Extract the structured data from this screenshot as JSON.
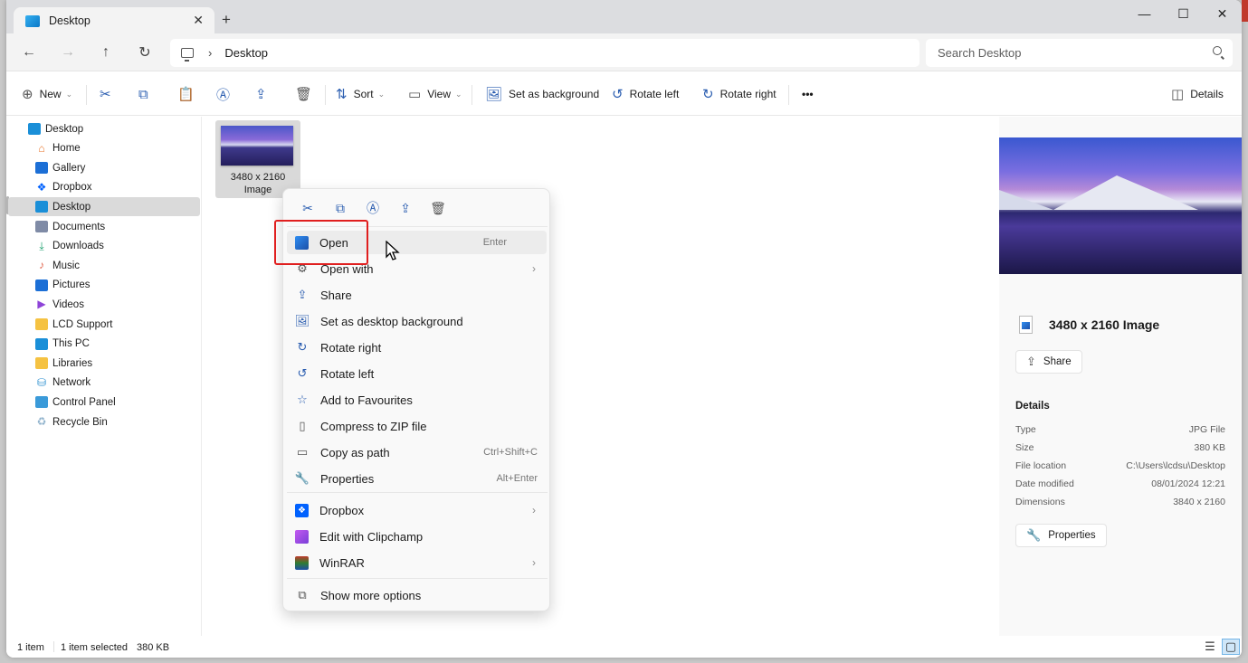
{
  "window": {
    "tab_title": "Desktop",
    "new_tab": "+",
    "controls": {
      "minimize": "—",
      "maximize": "☐",
      "close": "✕"
    }
  },
  "nav": {
    "back": "←",
    "forward": "→",
    "up": "↑",
    "refresh": "↻",
    "breadcrumb_sep": "›",
    "breadcrumb": [
      "Desktop"
    ],
    "search_placeholder": "Search Desktop"
  },
  "toolbar": {
    "new_label": "New",
    "sort_label": "Sort",
    "view_label": "View",
    "set_background_label": "Set as background",
    "rotate_left_label": "Rotate left",
    "rotate_right_label": "Rotate right",
    "more_label": "•••",
    "details_label": "Details"
  },
  "sidebar": {
    "items": [
      {
        "label": "Desktop",
        "icon": "desktop-icon",
        "color": "#1a8fd8"
      },
      {
        "label": "Home",
        "icon": "home-icon",
        "color": "#e8752c"
      },
      {
        "label": "Gallery",
        "icon": "gallery-icon",
        "color": "#1c6fd6"
      },
      {
        "label": "Dropbox",
        "icon": "dropbox-icon",
        "color": "#0061fe"
      },
      {
        "label": "Desktop",
        "icon": "desktop-icon",
        "color": "#1a8fd8",
        "selected": true
      },
      {
        "label": "Documents",
        "icon": "documents-icon",
        "color": "#7f8ba6"
      },
      {
        "label": "Downloads",
        "icon": "downloads-icon",
        "color": "#1a9e6c"
      },
      {
        "label": "Music",
        "icon": "music-icon",
        "color": "#e1654d"
      },
      {
        "label": "Pictures",
        "icon": "pictures-icon",
        "color": "#1c6fd6"
      },
      {
        "label": "Videos",
        "icon": "videos-icon",
        "color": "#8e44d8"
      },
      {
        "label": "LCD Support",
        "icon": "folder-icon",
        "color": "#f5c242"
      },
      {
        "label": "This PC",
        "icon": "this-pc-icon",
        "color": "#1a8fd8"
      },
      {
        "label": "Libraries",
        "icon": "libraries-icon",
        "color": "#f5c242"
      },
      {
        "label": "Network",
        "icon": "network-icon",
        "color": "#2c8fcf"
      },
      {
        "label": "Control Panel",
        "icon": "control-panel-icon",
        "color": "#3a9ad9"
      },
      {
        "label": "Recycle Bin",
        "icon": "recycle-bin-icon",
        "color": "#8fb2cc"
      }
    ]
  },
  "content": {
    "file": {
      "line1": "3480 x 2160",
      "line2": "Image"
    }
  },
  "context_menu": {
    "quick_actions": [
      "Cut",
      "Copy",
      "Rename",
      "Share",
      "Delete"
    ],
    "items": [
      {
        "label": "Open",
        "shortcut": "Enter",
        "icon": "photos-icon"
      },
      {
        "label": "Open with",
        "submenu": true,
        "icon": "open-with-icon"
      },
      {
        "label": "Share",
        "icon": "share-icon"
      },
      {
        "label": "Set as desktop background",
        "icon": "set-background-icon"
      },
      {
        "label": "Rotate right",
        "icon": "rotate-right-icon"
      },
      {
        "label": "Rotate left",
        "icon": "rotate-left-icon"
      },
      {
        "label": "Add to Favourites",
        "icon": "star-icon"
      },
      {
        "label": "Compress to ZIP file",
        "icon": "zip-icon"
      },
      {
        "label": "Copy as path",
        "shortcut": "Ctrl+Shift+C",
        "icon": "copy-path-icon"
      },
      {
        "label": "Properties",
        "shortcut": "Alt+Enter",
        "icon": "wrench-icon"
      },
      {
        "label": "Dropbox",
        "submenu": true,
        "icon": "dropbox-icon"
      },
      {
        "label": "Edit with Clipchamp",
        "icon": "clipchamp-icon"
      },
      {
        "label": "WinRAR",
        "submenu": true,
        "icon": "winrar-icon"
      },
      {
        "label": "Show more options",
        "icon": "more-options-icon"
      }
    ],
    "chevron": "›"
  },
  "details": {
    "title": "3480 x 2160 Image",
    "share_label": "Share",
    "section_title": "Details",
    "rows": [
      {
        "key": "Type",
        "value": "JPG File"
      },
      {
        "key": "Size",
        "value": "380 KB"
      },
      {
        "key": "File location",
        "value": "C:\\Users\\lcdsu\\Desktop"
      },
      {
        "key": "Date modified",
        "value": "08/01/2024 12:21"
      },
      {
        "key": "Dimensions",
        "value": "3840 x 2160"
      }
    ],
    "properties_label": "Properties"
  },
  "status": {
    "item_count": "1 item",
    "selection": "1 item selected",
    "size": "380 KB"
  },
  "colors": {
    "accent": "#2a5db0",
    "highlight_box": "#e01f1f",
    "selected_bg": "#dadada"
  }
}
